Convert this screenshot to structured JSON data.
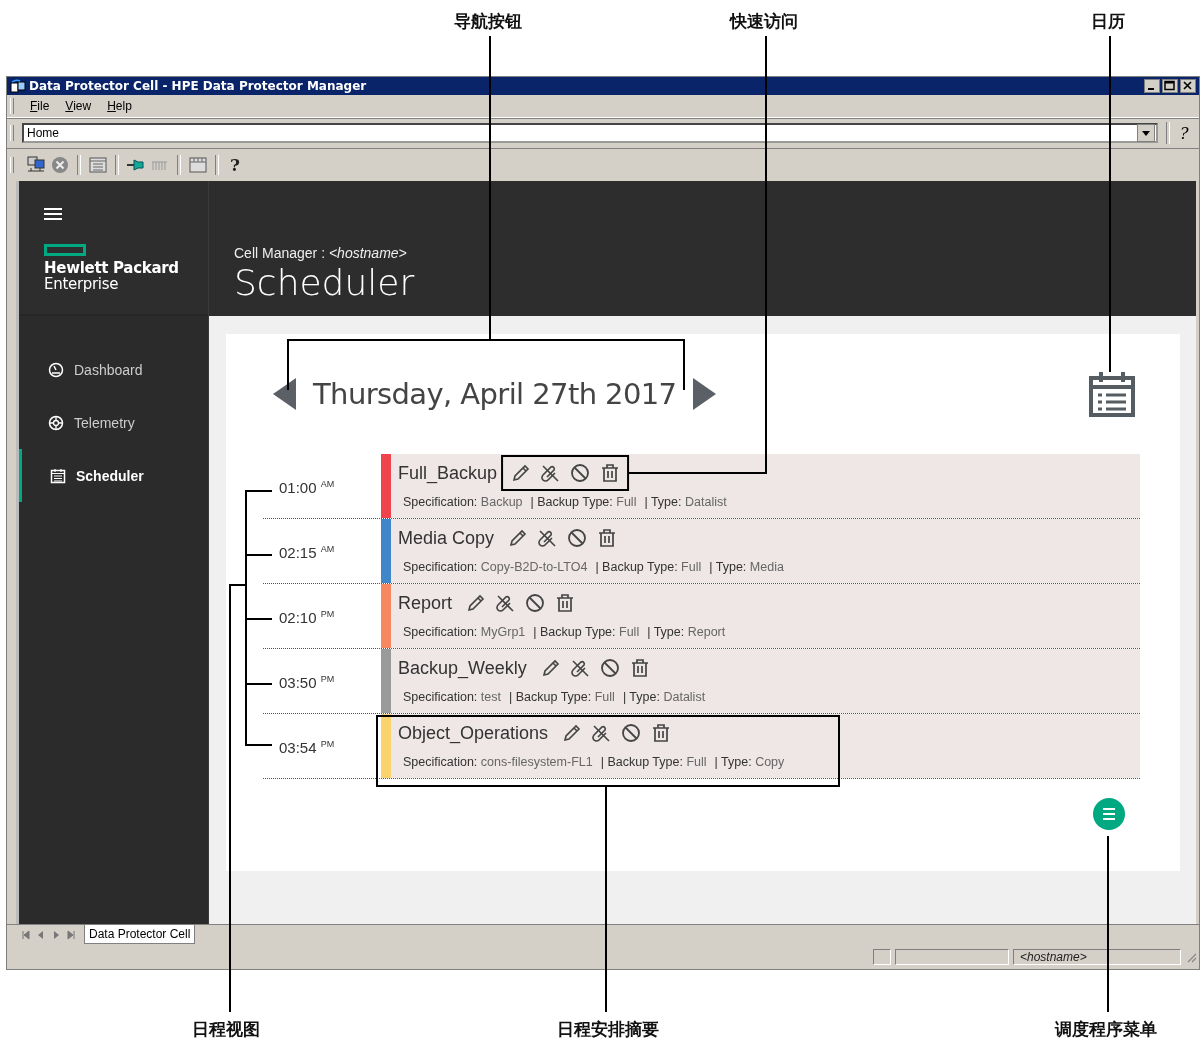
{
  "annotations": [
    {
      "text": "导航按钮"
    },
    {
      "text": "快速访问"
    },
    {
      "text": "日历"
    },
    {
      "text": "日程视图"
    },
    {
      "text": "日程安排摘要"
    },
    {
      "text": "调度程序菜单"
    }
  ],
  "window": {
    "title": "Data Protector Cell - HPE Data Protector Manager"
  },
  "menu": [
    "File",
    "View",
    "Help"
  ],
  "address": {
    "value": "Home"
  },
  "toolbar_help": "?",
  "sidebar": {
    "brand": [
      "Hewlett Packard",
      "Enterprise"
    ],
    "items": [
      {
        "label": "Dashboard",
        "selected": false
      },
      {
        "label": "Telemetry",
        "selected": false
      },
      {
        "label": "Scheduler",
        "selected": true
      }
    ]
  },
  "header": {
    "label": "Cell Manager :",
    "hostname": "<hostname>",
    "title": "Scheduler"
  },
  "date": "Thursday, April 27th 2017",
  "schedules": [
    {
      "time": "01:00 $^{AM}$",
      "name": "Full_Backup",
      "color": "#f0434b",
      "details": [
        {
          "label": "Specification:",
          "value": "Backup"
        },
        {
          "label": "| Backup Type:",
          "value": "Full"
        },
        {
          "label": "| Type:",
          "value": "Datalist"
        }
      ]
    },
    {
      "time": "02:15 $^{AM}$",
      "name": "Media Copy",
      "color": "#3f87c8",
      "details": [
        {
          "label": "Specification:",
          "value": "Copy-B2D-to-LTO4"
        },
        {
          "label": "| Backup Type:",
          "value": "Full"
        },
        {
          "label": "| Type:",
          "value": "Media"
        }
      ]
    },
    {
      "time": "02:10 $^{PM}$",
      "name": "Report",
      "color": "#f7875f",
      "details": [
        {
          "label": "Specification:",
          "value": "MyGrp1"
        },
        {
          "label": "| Backup Type:",
          "value": "Full"
        },
        {
          "label": "| Type:",
          "value": "Report"
        }
      ]
    },
    {
      "time": "03:50 $^{PM}$",
      "name": "Backup_Weekly",
      "color": "#9a9a9a",
      "details": [
        {
          "label": "Specification:",
          "value": "test"
        },
        {
          "label": "| Backup Type:",
          "value": "Full"
        },
        {
          "label": "| Type:",
          "value": "Datalist"
        }
      ]
    },
    {
      "time": "03:54 $^{PM}$",
      "name": "Object_Operations",
      "color": "#fbd36c",
      "details": [
        {
          "label": "Specification:",
          "value": "cons-filesystem-FL1"
        },
        {
          "label": "| Backup Type:",
          "value": "Full"
        },
        {
          "label": "| Type:",
          "value": "Copy"
        }
      ]
    }
  ],
  "tabs": [
    {
      "label": "Data Protector Cell",
      "selected": true
    }
  ],
  "status_bar": {
    "host": "<hostname>"
  }
}
